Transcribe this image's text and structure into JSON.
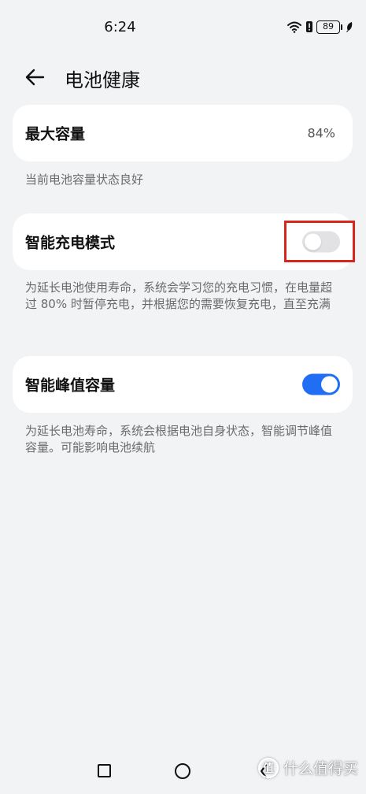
{
  "status_bar": {
    "time": "6:24",
    "battery_level": "89"
  },
  "header": {
    "title": "电池健康"
  },
  "max_capacity": {
    "label": "最大容量",
    "value": "84%",
    "description": "当前电池容量状态良好"
  },
  "smart_charging": {
    "label": "智能充电模式",
    "enabled": false,
    "description": "为延长电池使用寿命，系统会学习您的充电习惯，在电量超过 80% 时暂停充电，并根据您的需要恢复充电，直至充满"
  },
  "smart_peak_capacity": {
    "label": "智能峰值容量",
    "enabled": true,
    "description": "为延长电池寿命，系统会根据电池自身状态，智能调节峰值容量。可能影响电池续航"
  },
  "colors": {
    "toggle_on": "#1f6ef4",
    "toggle_off": "#e2e2e4",
    "highlight": "#d9261c",
    "background": "#f1f3f5"
  },
  "watermark": {
    "logo_char": "值",
    "text": "什么值得买"
  },
  "icons": [
    "wifi-icon",
    "alert-icon",
    "battery-icon",
    "leaf-icon",
    "back-arrow-icon",
    "nav-recent-icon",
    "nav-home-icon",
    "nav-back-icon"
  ]
}
